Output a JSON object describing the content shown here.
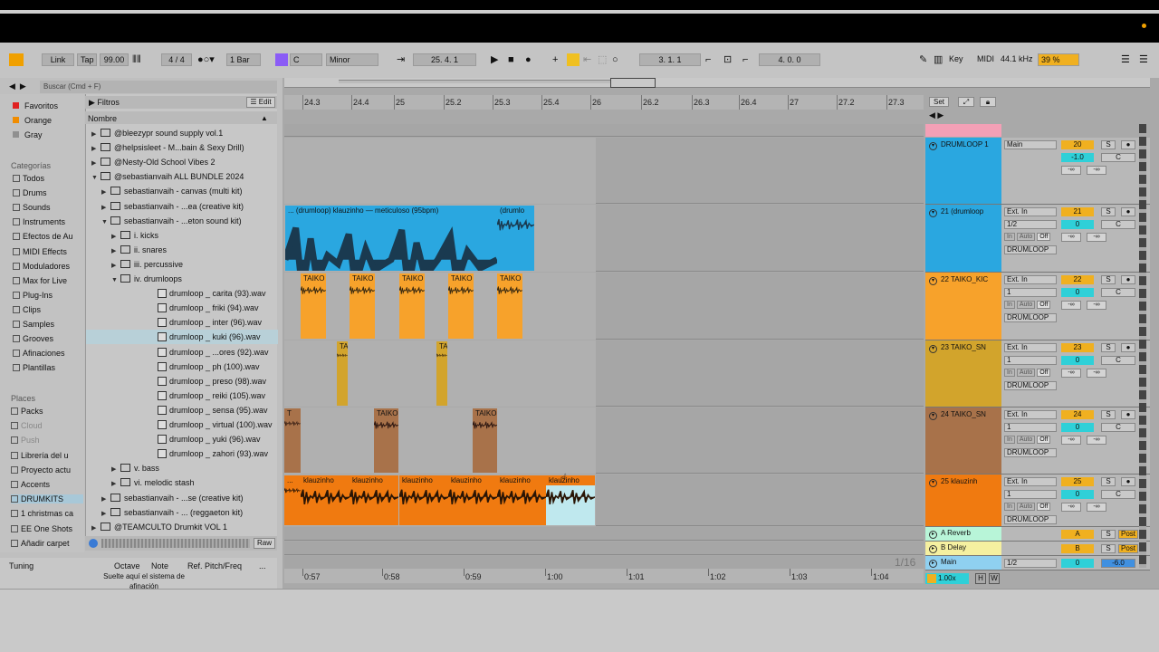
{
  "transport": {
    "link": "Link",
    "tap": "Tap",
    "tempo": "99.00",
    "signature": "4 / 4",
    "quant": "1 Bar",
    "key": "C",
    "scale": "Minor",
    "position": "25.  4.  1",
    "loop_start": "3.  1.  1",
    "loop_len": "4.  0.  0",
    "key_btn": "Key",
    "midi_btn": "MIDI",
    "sample_rate": "44.1 kHz",
    "cpu": "39 %"
  },
  "browser": {
    "search_placeholder": "Buscar (Cmd + F)",
    "filters": "Filtros",
    "edit": "Edit",
    "name_col": "Nombre",
    "raw": "Raw",
    "collections": [
      "Favoritos",
      "Orange",
      "Gray"
    ],
    "collection_colors": [
      "#e02020",
      "#f08c00",
      "#909090"
    ],
    "categories_label": "Categorías",
    "categories": [
      "Todos",
      "Drums",
      "Sounds",
      "Instruments",
      "Efectos de Au",
      "MIDI Effects",
      "Moduladores",
      "Max for Live",
      "Plug-Ins",
      "Clips",
      "Samples",
      "Grooves",
      "Afinaciones",
      "Plantillas"
    ],
    "places_label": "Places",
    "places": [
      "Packs",
      "Cloud",
      "Push",
      "Librería del u",
      "Proyecto actu",
      "Accents",
      "DRUMKITS",
      "1 christmas ca",
      "EE One Shots",
      "Añadir carpet"
    ],
    "tree": [
      {
        "label": "@bleezypr sound supply vol.1",
        "indent": 0,
        "type": "folder"
      },
      {
        "label": "@helpsisleet - M...bain & Sexy Drill)",
        "indent": 0,
        "type": "folder"
      },
      {
        "label": "@Nesty-Old School Vibes 2",
        "indent": 0,
        "type": "folder"
      },
      {
        "label": "@sebastianvaih ALL BUNDLE 2024",
        "indent": 0,
        "type": "folder",
        "open": true
      },
      {
        "label": "sebastianvaih - canvas (multi kit)",
        "indent": 1,
        "type": "folder"
      },
      {
        "label": "sebastianvaih - ...ea (creative kit)",
        "indent": 1,
        "type": "folder"
      },
      {
        "label": "sebastianvaih - ...eton sound kit)",
        "indent": 1,
        "type": "folder",
        "open": true
      },
      {
        "label": "i. kicks",
        "indent": 2,
        "type": "folder"
      },
      {
        "label": "ii. snares",
        "indent": 2,
        "type": "folder"
      },
      {
        "label": "iii. percussive",
        "indent": 2,
        "type": "folder"
      },
      {
        "label": "iv. drumloops",
        "indent": 2,
        "type": "folder",
        "open": true
      },
      {
        "label": "drumloop _ carita (93).wav",
        "indent": 3,
        "type": "file"
      },
      {
        "label": "drumloop _ friki (94).wav",
        "indent": 3,
        "type": "file"
      },
      {
        "label": "drumloop _ inter (96).wav",
        "indent": 3,
        "type": "file"
      },
      {
        "label": "drumloop _ kuki (96).wav",
        "indent": 3,
        "type": "file",
        "selected": true
      },
      {
        "label": "drumloop _ ...ores (92).wav",
        "indent": 3,
        "type": "file"
      },
      {
        "label": "drumloop _ ph (100).wav",
        "indent": 3,
        "type": "file"
      },
      {
        "label": "drumloop _ preso (98).wav",
        "indent": 3,
        "type": "file"
      },
      {
        "label": "drumloop _ reiki (105).wav",
        "indent": 3,
        "type": "file"
      },
      {
        "label": "drumloop _ sensa (95).wav",
        "indent": 3,
        "type": "file"
      },
      {
        "label": "drumloop _ virtual (100).wav",
        "indent": 3,
        "type": "file"
      },
      {
        "label": "drumloop _ yuki (96).wav",
        "indent": 3,
        "type": "file"
      },
      {
        "label": "drumloop _ zahori (93).wav",
        "indent": 3,
        "type": "file"
      },
      {
        "label": "v. bass",
        "indent": 2,
        "type": "folder"
      },
      {
        "label": "vi. melodic stash",
        "indent": 2,
        "type": "folder"
      },
      {
        "label": "sebastianvaih - ...se (creative kit)",
        "indent": 1,
        "type": "folder"
      },
      {
        "label": "sebastianvaih - ... (reggaeton kit)",
        "indent": 1,
        "type": "folder"
      },
      {
        "label": "@TEAMCULTO Drumkit VOL 1",
        "indent": 0,
        "type": "folder"
      }
    ]
  },
  "tuning": {
    "title": "Tuning",
    "octave": "Octave",
    "note": "Note",
    "ref": "Ref. Pitch/Freq",
    "more": "...",
    "hint": "Suelte aquí el sistema de afinación"
  },
  "ruler": {
    "bars": [
      "24.3",
      "24.4",
      "25",
      "25.2",
      "25.3",
      "25.4",
      "26",
      "26.2",
      "26.3",
      "26.4",
      "27",
      "27.2",
      "27.3"
    ],
    "set": "Set"
  },
  "timeline": {
    "times": [
      "0:57",
      "0:58",
      "0:59",
      "1:00",
      "1:01",
      "1:02",
      "1:03",
      "1:04"
    ],
    "grid": "1/16"
  },
  "tracks": [
    {
      "name": "DRUMLOOP 1",
      "color": "#2aa7e0",
      "number": "20",
      "out": "Main",
      "io2": "",
      "vol": "-1.0",
      "pan": "C"
    },
    {
      "name": "21 (drumloop",
      "color": "#2aa7e0",
      "number": "21",
      "out": "Ext. In",
      "io2": "1/2",
      "vol": "0",
      "pan": "C",
      "dest": "DRUMLOOP"
    },
    {
      "name": "22 TAIKO_KIC",
      "color": "#f7a22b",
      "number": "22",
      "out": "Ext. In",
      "io2": "1",
      "vol": "0",
      "pan": "C",
      "dest": "DRUMLOOP"
    },
    {
      "name": "23 TAIKO_SN",
      "color": "#d2a42c",
      "number": "23",
      "out": "Ext. In",
      "io2": "1",
      "vol": "0",
      "pan": "C",
      "dest": "DRUMLOOP"
    },
    {
      "name": "24 TAIKO_SN",
      "color": "#a8724a",
      "number": "24",
      "out": "Ext. In",
      "io2": "1",
      "vol": "0",
      "pan": "C",
      "dest": "DRUMLOOP"
    },
    {
      "name": "25      klauzinh",
      "color": "#f07a10",
      "number": "25",
      "out": "Ext. In",
      "io2": "1",
      "vol": "0",
      "pan": "C",
      "dest": "DRUMLOOP"
    }
  ],
  "mixer": {
    "in": "In",
    "auto": "Auto",
    "off": "Off",
    "solo": "S",
    "neg_inf": "-∞"
  },
  "returns": [
    {
      "name": "A Reverb",
      "letter": "A",
      "color": "#b8f5d8"
    },
    {
      "name": "B Delay",
      "letter": "B",
      "color": "#f5f0a0"
    }
  ],
  "master": {
    "name": "Main",
    "out": "1/2",
    "vol": "0",
    "pan": "-6.0"
  },
  "post": "Post",
  "zoom": "1.00x",
  "clips": {
    "drumloop_a": "... (drumloop) klauzinho — meticuloso (95bpm)",
    "drumloop_b": "(drumlo",
    "taiko": "TAIKO",
    "ta": "TA",
    "t": "T",
    "klauzinho": "klauzinho",
    "dots": "..."
  }
}
